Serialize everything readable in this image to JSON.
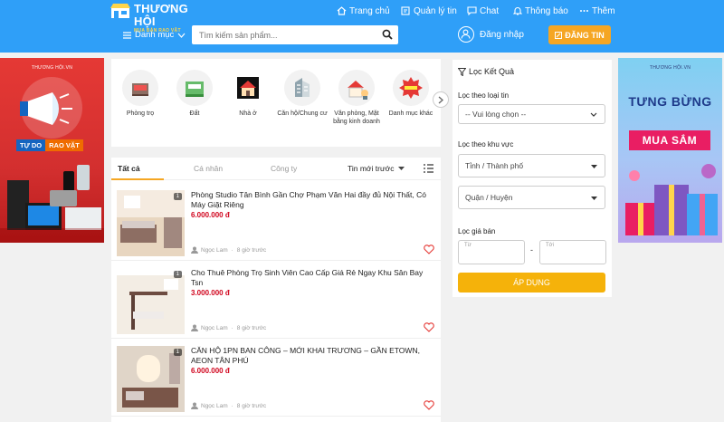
{
  "header": {
    "logo_title": "THƯƠNG HỘI",
    "logo_sub": "MUA BÁN RAO VẶT",
    "nav": [
      {
        "label": "Trang chủ",
        "icon": "home-icon"
      },
      {
        "label": "Quản lý tin",
        "icon": "manage-icon"
      },
      {
        "label": "Chat",
        "icon": "chat-icon"
      },
      {
        "label": "Thông báo",
        "icon": "bell-icon"
      },
      {
        "label": "Thêm",
        "icon": "more-icon"
      }
    ],
    "category_label": "Danh mục",
    "search_placeholder": "Tìm kiếm sản phẩm...",
    "login_label": "Đăng nhập",
    "post_label": "ĐĂNG TIN"
  },
  "banners": {
    "left": {
      "brand": "THƯƠNG HỘI.VN",
      "tag1": "TỰ DO",
      "tag2": "RAO VẶT"
    },
    "right": {
      "brand": "THƯƠNG HỘI.VN",
      "line1": "TƯNG BỪNG",
      "line2": "MUA SẮM"
    }
  },
  "categories": [
    {
      "label": "Phòng trọ",
      "icon": "room-icon"
    },
    {
      "label": "Đất",
      "icon": "land-icon"
    },
    {
      "label": "Nhà ở",
      "icon": "house-icon"
    },
    {
      "label": "Căn hộ/Chung cư",
      "icon": "apartment-icon"
    },
    {
      "label": "Văn phòng, Mặt bằng kinh doanh",
      "icon": "office-icon"
    },
    {
      "label": "Danh mục khác",
      "icon": "sale-icon"
    }
  ],
  "tabs": [
    "Tất cả",
    "Cá nhân",
    "Công ty"
  ],
  "sort_label": "Tin mới trước",
  "listings": [
    {
      "title": "Phòng Studio Tân Bình Gần Chợ Phạm Văn Hai đầy đủ Nội Thất, Có Máy Giặt Riêng",
      "price": "6.000.000 đ",
      "user": "Ngọc Lam",
      "time": "8 giờ trước",
      "count": "1"
    },
    {
      "title": "Cho Thuê Phòng Trọ Sinh Viên Cao Cấp Giá Rẻ Ngay Khu Sân Bay Tsn",
      "price": "3.000.000 đ",
      "user": "Ngọc Lam",
      "time": "8 giờ trước",
      "count": "1"
    },
    {
      "title": "CĂN HỘ 1PN BAN CÔNG – MỚI KHAI TRƯƠNG – GẦN ETOWN, AEON TÂN PHÚ",
      "price": "6.000.000 đ",
      "user": "Ngọc Lam",
      "time": "8 giờ trước",
      "count": "1"
    }
  ],
  "filter": {
    "title": "Lọc Kết Quả",
    "type_label": "Lọc theo loại tin",
    "type_value": "-- Vui lòng chọn --",
    "area_label": "Lọc theo khu vực",
    "province": "Tỉnh / Thành phố",
    "district": "Quận / Huyện",
    "price_label": "Lọc giá bán",
    "from": "Từ",
    "to": "Tới",
    "dash": "-",
    "apply": "ÁP DỤNG"
  }
}
